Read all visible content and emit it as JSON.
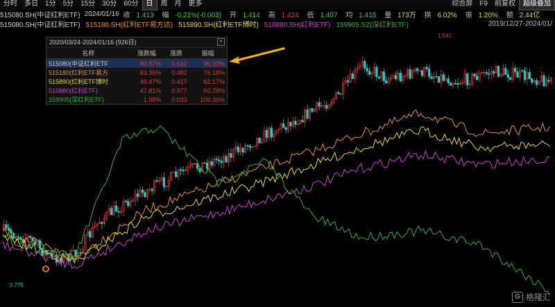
{
  "toolbar": {
    "left": [
      "分时",
      "多日",
      "1分",
      "5分",
      "15分",
      "30分",
      "60分",
      "日",
      "周",
      "月",
      "更多"
    ],
    "active_index": 7,
    "right": [
      "综合屏",
      "F9",
      "前复权",
      "超级叠加"
    ],
    "right_active_index": 3
  },
  "info": {
    "symbol": "515080.SH(中证红利ETF)",
    "date": "2024/01/16",
    "close_label": "收",
    "close": "1.413",
    "change_label": "幅",
    "change": "-0.21%(-0.003)",
    "open_label": "开",
    "open": "1.414",
    "high_label": "高",
    "high": "1.424",
    "low_label": "低",
    "low": "1.407",
    "avg_label": "均",
    "avg": "1.415",
    "volume_label": "量",
    "volume": "173万",
    "turnover_label": "换",
    "turnover": "6.02%",
    "amplitude_label": "振",
    "amplitude": "1.20%",
    "amount_label": "额",
    "amount": "2.44亿"
  },
  "legend": {
    "items": [
      {
        "label": "515080.SH(中证红利ETF)",
        "color": "#cfcfcf"
      },
      {
        "label": "515180.SH(红利ETF易方达)",
        "color": "#e8953a"
      },
      {
        "label": "515890.SH(红利ETF博时)",
        "color": "#e8d84a"
      },
      {
        "label": "510880.SH(红利ETF)",
        "color": "#d13fd1"
      },
      {
        "label": "159905.SZ(深红利ETF)",
        "color": "#3fae3f"
      }
    ],
    "range": "2019/12/27-2024/01/"
  },
  "chart_annotations": {
    "high_label": "1.541",
    "low_label": "0.775"
  },
  "popup": {
    "title": "2020/03/24-2024/01/16 (926日)",
    "columns": [
      "名称",
      "涨跌幅",
      "涨跌",
      "振幅"
    ],
    "rows": [
      {
        "name": "515080(中证红利ETF",
        "pct": "80.87%",
        "chg": "0.632",
        "amp": "96.93%",
        "color": "#cfcfcf"
      },
      {
        "name": "515180(红利ETF易方",
        "pct": "63.35%",
        "chg": "0.482",
        "amp": "76.18%",
        "color": "#e8953a"
      },
      {
        "name": "515890(红利ETF博时",
        "pct": "49.47%",
        "chg": "0.417",
        "amp": "62.17%",
        "color": "#e8d84a"
      },
      {
        "name": "510880(红利ETF)",
        "pct": "47.81%",
        "chg": "0.977",
        "amp": "60.29%",
        "color": "#d13fd1"
      },
      {
        "name": "159905(深红利ETF)",
        "pct": "1.98%",
        "chg": "0.033",
        "amp": "100.36%",
        "color": "#3fae3f"
      }
    ]
  },
  "colors": {
    "up": "#e23b3b",
    "down": "#28c8c8",
    "arrow": "#f0b020",
    "bg": "#000000"
  },
  "watermark": {
    "text": "格隆汇"
  }
}
